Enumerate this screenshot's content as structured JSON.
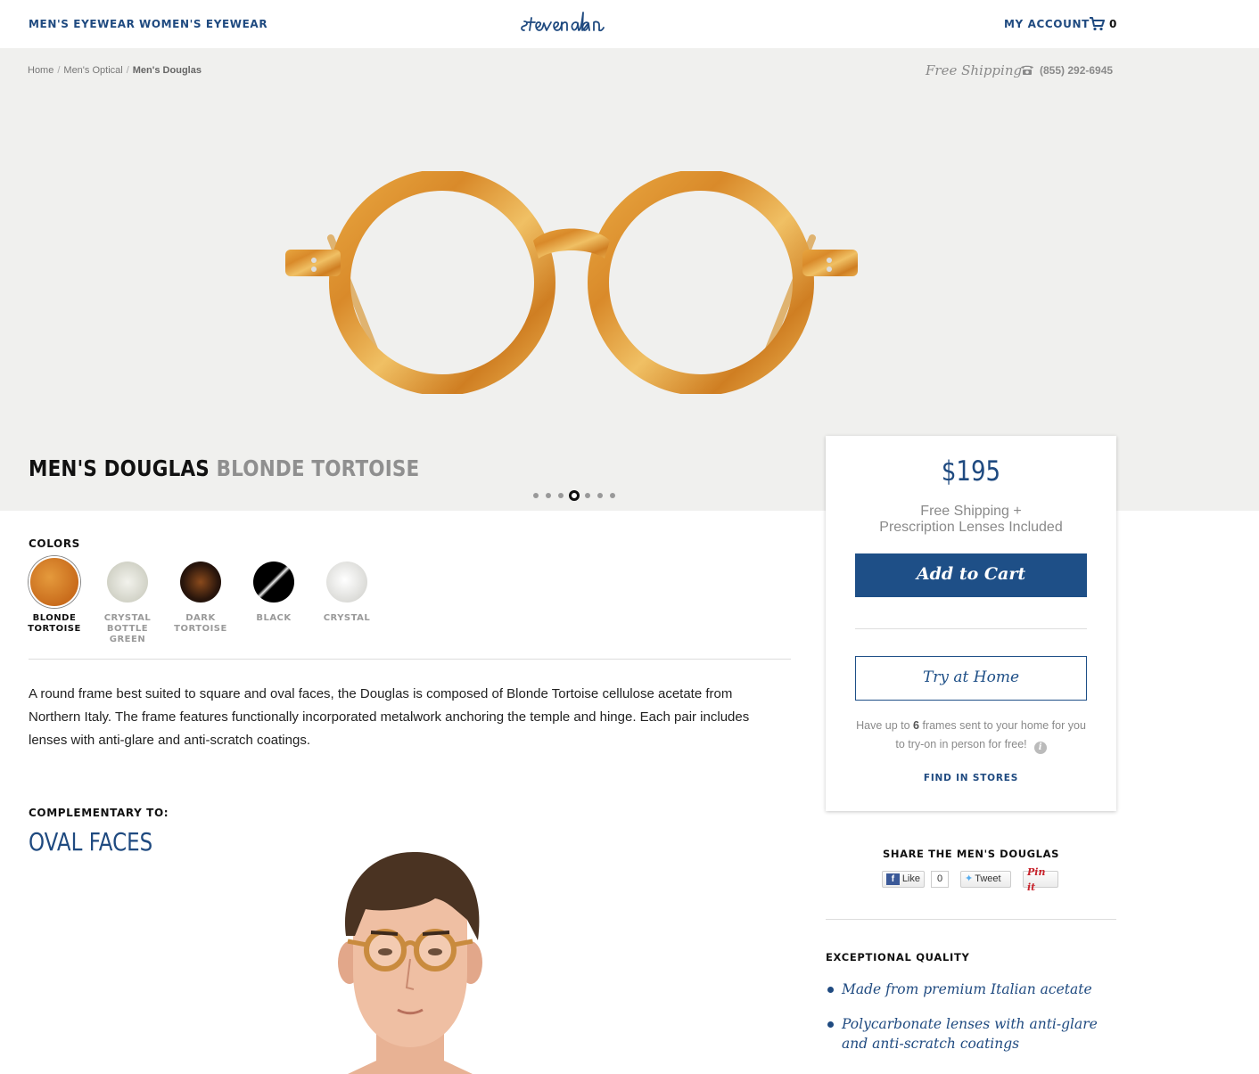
{
  "header": {
    "nav": [
      "MEN'S EYEWEAR",
      "WOMEN'S EYEWEAR"
    ],
    "logo": "steven alan",
    "account": "MY ACCOUNT",
    "cart_count": "0"
  },
  "breadcrumb": [
    "Home",
    "Men's Optical",
    "Men's Douglas"
  ],
  "shipping": {
    "text": "Free Shipping",
    "phone": "(855) 292-6945"
  },
  "product": {
    "name": "MEN'S DOUGLAS",
    "color": "BLONDE TORTOISE",
    "gallery_total": 7,
    "gallery_active": 4
  },
  "colors": {
    "label": "COLORS",
    "options": [
      {
        "name": "BLONDE TORTOISE",
        "selected": true,
        "swatch": "#d9822b"
      },
      {
        "name": "CRYSTAL BOTTLE GREEN",
        "selected": false,
        "swatch": "#dcdcd2"
      },
      {
        "name": "DARK TORTOISE",
        "selected": false,
        "swatch": "#3a2216"
      },
      {
        "name": "BLACK",
        "selected": false,
        "swatch": "#0b0b0b"
      },
      {
        "name": "CRYSTAL",
        "selected": false,
        "swatch": "#e9e9e6"
      }
    ]
  },
  "description": "A round frame best suited to square and oval faces, the Douglas is composed of Blonde Tortoise cellulose acetate from Northern Italy. The frame features functionally incorporated metalwork anchoring the temple and hinge. Each pair includes lenses with anti-glare and anti-scratch coatings.",
  "complementary": {
    "label": "COMPLEMENTARY TO:",
    "shape": "OVAL FACES"
  },
  "purchase": {
    "price": "$195",
    "note_line1": "Free Shipping +",
    "note_line2": "Prescription Lenses Included",
    "add_to_cart": "Add to Cart",
    "try_at_home": "Try at Home",
    "try_note_before": "Have up to ",
    "try_note_count": "6",
    "try_note_after": " frames sent to your home for you to try-on in person for free!",
    "find_in_stores": "FIND IN STORES"
  },
  "share": {
    "title": "SHARE THE MEN'S DOUGLAS",
    "like": "Like",
    "like_count": "0",
    "tweet": "Tweet",
    "pin": "Pin it"
  },
  "quality": {
    "title": "EXCEPTIONAL QUALITY",
    "items": [
      "Made from premium Italian acetate",
      "Polycarbonate lenses with anti-glare and anti-scratch coatings"
    ]
  },
  "colors_theme": {
    "brand_blue": "#1f4a80",
    "button_blue": "#1e4f87",
    "hero_bg": "#f0f0ee"
  }
}
